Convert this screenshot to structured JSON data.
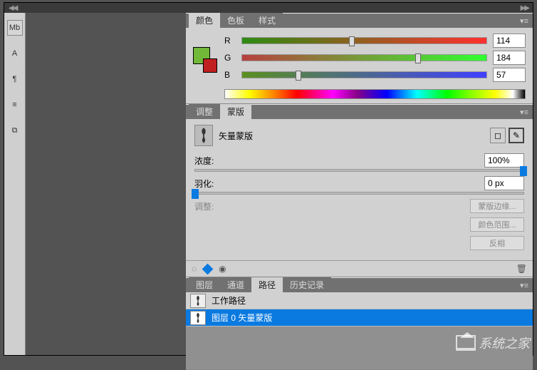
{
  "toolbar": {
    "items": [
      "Mb",
      "A",
      "¶",
      "≡",
      "⧉"
    ]
  },
  "color_panel": {
    "tabs": {
      "color": "颜色",
      "swatches": "色板",
      "styles": "样式"
    },
    "channels": {
      "r": {
        "label": "R",
        "value": "114",
        "pos": 45
      },
      "g": {
        "label": "G",
        "value": "184",
        "pos": 72
      },
      "b": {
        "label": "B",
        "value": "57",
        "pos": 23
      }
    },
    "fg_color": "#72b839",
    "bg_color": "#c02020"
  },
  "mask_panel": {
    "tabs": {
      "adjust": "调整",
      "mask": "蒙版"
    },
    "title": "矢量蒙版",
    "density": {
      "label": "浓度:",
      "value": "100%",
      "pos": 100
    },
    "feather": {
      "label": "羽化:",
      "value": "0 px",
      "pos": 0
    },
    "adjust_label": "调整:",
    "buttons": {
      "edge": "蒙版边缘...",
      "range": "颜色范围...",
      "invert": "反相"
    }
  },
  "paths_panel": {
    "tabs": {
      "layers": "图层",
      "channels": "通道",
      "paths": "路径",
      "history": "历史记录"
    },
    "items": [
      {
        "label": "工作路径",
        "selected": false
      },
      {
        "label": "图层 0 矢量蒙版",
        "selected": true
      }
    ]
  },
  "watermark": "系统之家"
}
